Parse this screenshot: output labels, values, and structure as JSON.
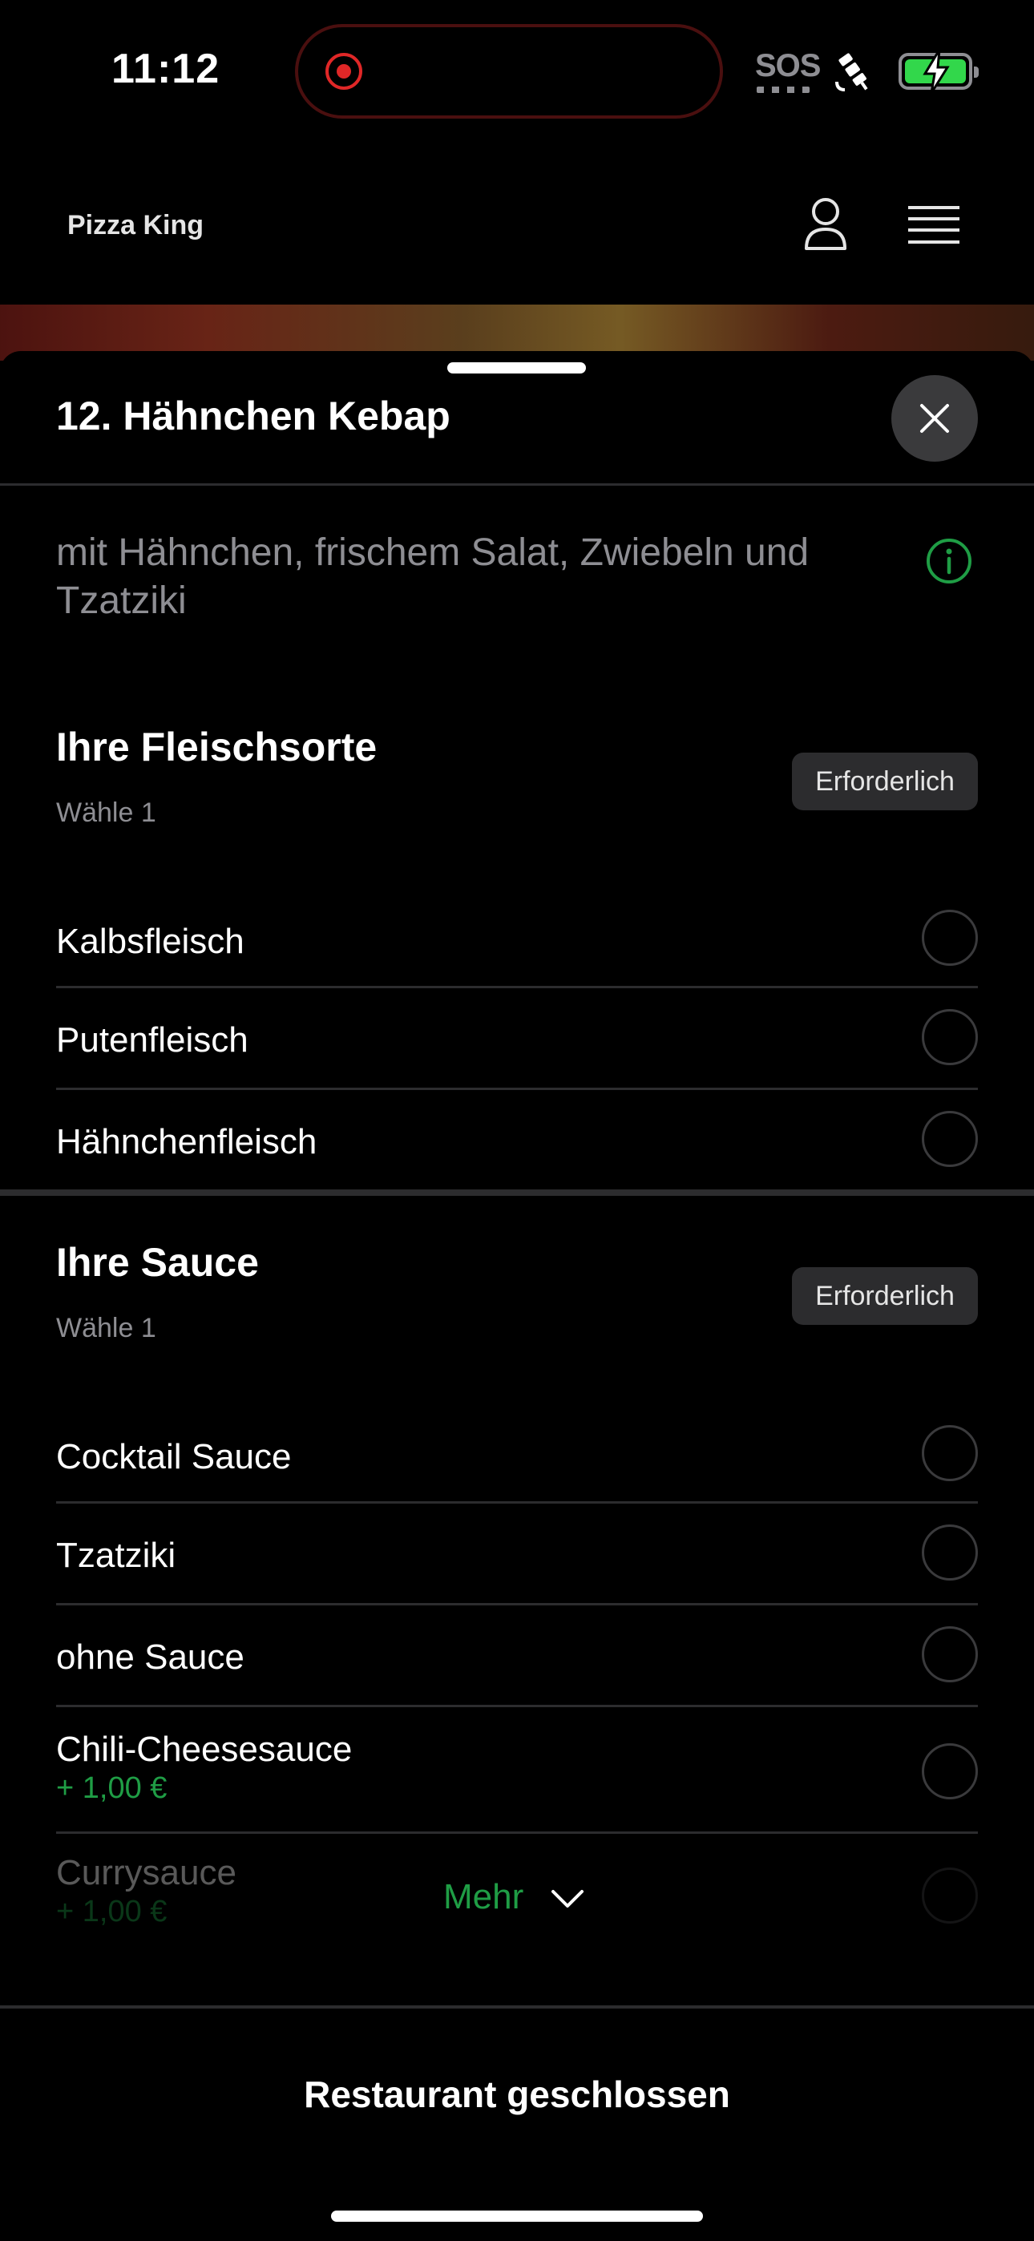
{
  "status_bar": {
    "time": "11:12",
    "sos": "SOS",
    "icons": [
      "record-icon",
      "satellite-icon",
      "battery-charging-icon"
    ],
    "battery_color": "#32d74b",
    "record_color": "#e02727"
  },
  "header": {
    "title": "Pizza King",
    "icons": [
      "user-icon",
      "menu-icon"
    ]
  },
  "sheet": {
    "title": "12. Hähnchen Kebap",
    "description": "mit Hähnchen, frischem Salat, Zwiebeln und Tzatziki",
    "groups": [
      {
        "title": "Ihre Fleischsorte",
        "subtitle": "Wähle 1",
        "badge": "Erforderlich",
        "options": [
          {
            "label": "Kalbsfleisch"
          },
          {
            "label": "Putenfleisch"
          },
          {
            "label": "Hähnchenfleisch"
          }
        ]
      },
      {
        "title": "Ihre Sauce",
        "subtitle": "Wähle 1",
        "badge": "Erforderlich",
        "options": [
          {
            "label": "Cocktail Sauce"
          },
          {
            "label": "Tzatziki"
          },
          {
            "label": "ohne Sauce"
          },
          {
            "label": "Chili-Cheesesauce",
            "price": "+ 1,00 €"
          },
          {
            "label": "Currysauce",
            "price": "+ 1,00 €"
          }
        ]
      }
    ],
    "more_label": "Mehr",
    "footer_label": "Restaurant geschlossen"
  },
  "colors": {
    "accent_green": "#1f9d45",
    "background": "#000000",
    "badge_bg": "#2c2c2e"
  }
}
